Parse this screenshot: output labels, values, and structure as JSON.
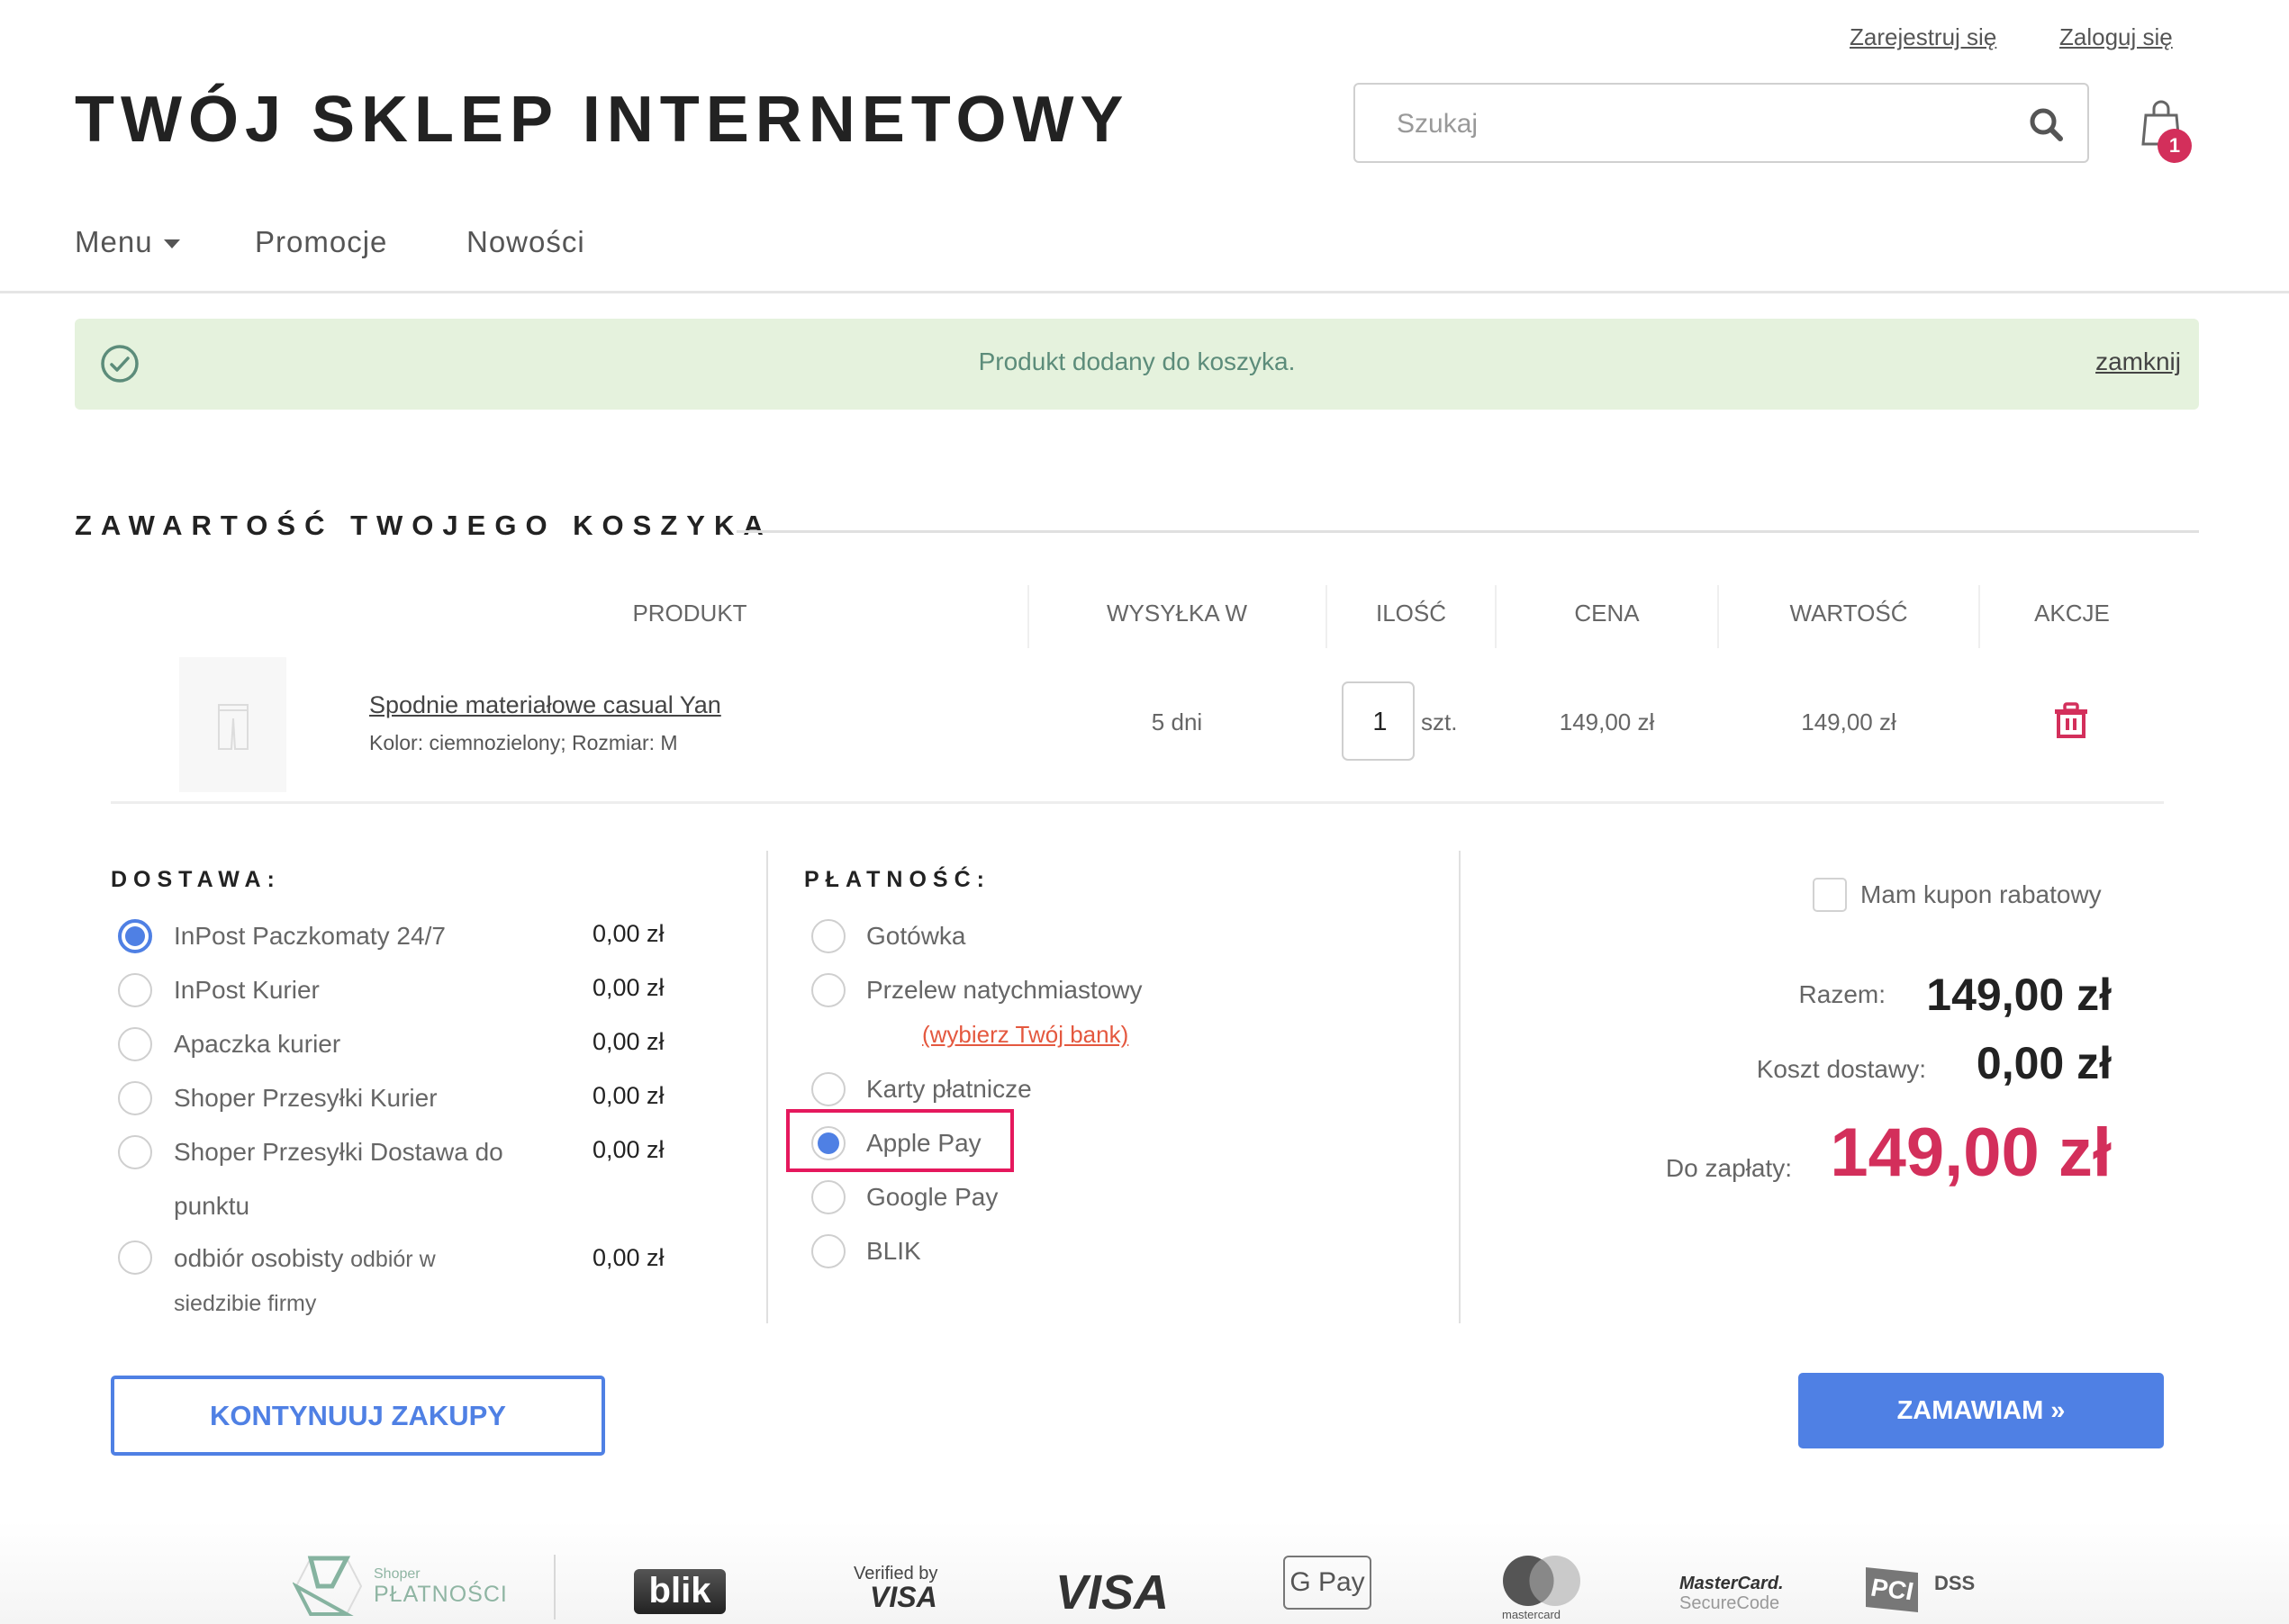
{
  "header": {
    "register_link": "Zarejestruj się",
    "login_link": "Zaloguj się",
    "store_title": "TWÓJ SKLEP INTERNETOWY",
    "search_placeholder": "Szukaj",
    "cart_count": "1",
    "nav": [
      {
        "label": "Menu",
        "icon": "chevron-down-icon"
      },
      {
        "label": "Promocje"
      },
      {
        "label": "Nowości"
      }
    ]
  },
  "alert": {
    "icon": "check-circle-icon",
    "message": "Produkt dodany do koszyka.",
    "close_label": "zamknij"
  },
  "cart": {
    "title": "ZAWARTOŚĆ TWOJEGO KOSZYKA",
    "columns": [
      "PRODUKT",
      "WYSYŁKA W",
      "ILOŚĆ",
      "CENA",
      "WARTOŚĆ",
      "AKCJE"
    ],
    "items": [
      {
        "name": "Spodnie materiałowe casual Yan",
        "attributes": "Kolor: ciemnozielony; Rozmiar: M",
        "shipping_time": "5 dni",
        "quantity": "1",
        "unit": "szt.",
        "price": "149,00 zł",
        "value": "149,00 zł",
        "action_icon": "trash-icon"
      }
    ]
  },
  "delivery": {
    "title": "DOSTAWA:",
    "options": [
      {
        "label": "InPost Paczkomaty 24/7",
        "price": "0,00 zł",
        "selected": true
      },
      {
        "label": "InPost Kurier",
        "price": "0,00 zł",
        "selected": false
      },
      {
        "label": "Apaczka kurier",
        "price": "0,00 zł",
        "selected": false
      },
      {
        "label": "Shoper Przesyłki Kurier",
        "price": "0,00 zł",
        "selected": false
      },
      {
        "label": "Shoper Przesyłki Dostawa do",
        "label_line2": "punktu",
        "price": "0,00 zł",
        "selected": false
      },
      {
        "label": "odbiór osobisty",
        "sublabel": "odbiór w",
        "label_line2": "siedzibie firmy",
        "price": "0,00 zł",
        "selected": false
      }
    ]
  },
  "payment": {
    "title": "PŁATNOŚĆ:",
    "options": [
      {
        "label": "Gotówka",
        "selected": false
      },
      {
        "label": "Przelew natychmiastowy",
        "link": "(wybierz Twój bank)",
        "selected": false
      },
      {
        "label": "Karty płatnicze",
        "selected": false
      },
      {
        "label": "Apple Pay",
        "selected": true,
        "highlighted": true
      },
      {
        "label": "Google Pay",
        "selected": false
      },
      {
        "label": "BLIK",
        "selected": false
      }
    ]
  },
  "summary": {
    "coupon_label": "Mam kupon rabatowy",
    "coupon_checked": false,
    "total_label": "Razem:",
    "total_value": "149,00 zł",
    "shipping_label": "Koszt dostawy:",
    "shipping_value": "0,00 zł",
    "due_label": "Do zapłaty:",
    "due_value": "149,00 zł"
  },
  "buttons": {
    "continue": "KONTYNUUJ ZAKUPY",
    "order": "ZAMAWIAM »"
  },
  "footer_logos": {
    "shoper_small": "Shoper",
    "shoper_big": "PŁATNOŚCI",
    "blik": "blik",
    "verified_top": "Verified by",
    "verified_bottom": "VISA",
    "visa": "VISA",
    "gpay": "G Pay",
    "mastercard": "mastercard",
    "securecode_top": "MasterCard.",
    "securecode_bottom": "SecureCode",
    "pci": "PCI",
    "dss": "DSS"
  },
  "colors": {
    "accent": "#4f80e4",
    "danger": "#d32f5b",
    "success_bg": "#e5f2dd",
    "success_text": "#5c8c7a",
    "highlight": "#e5185d",
    "link_red": "#e4583f"
  }
}
